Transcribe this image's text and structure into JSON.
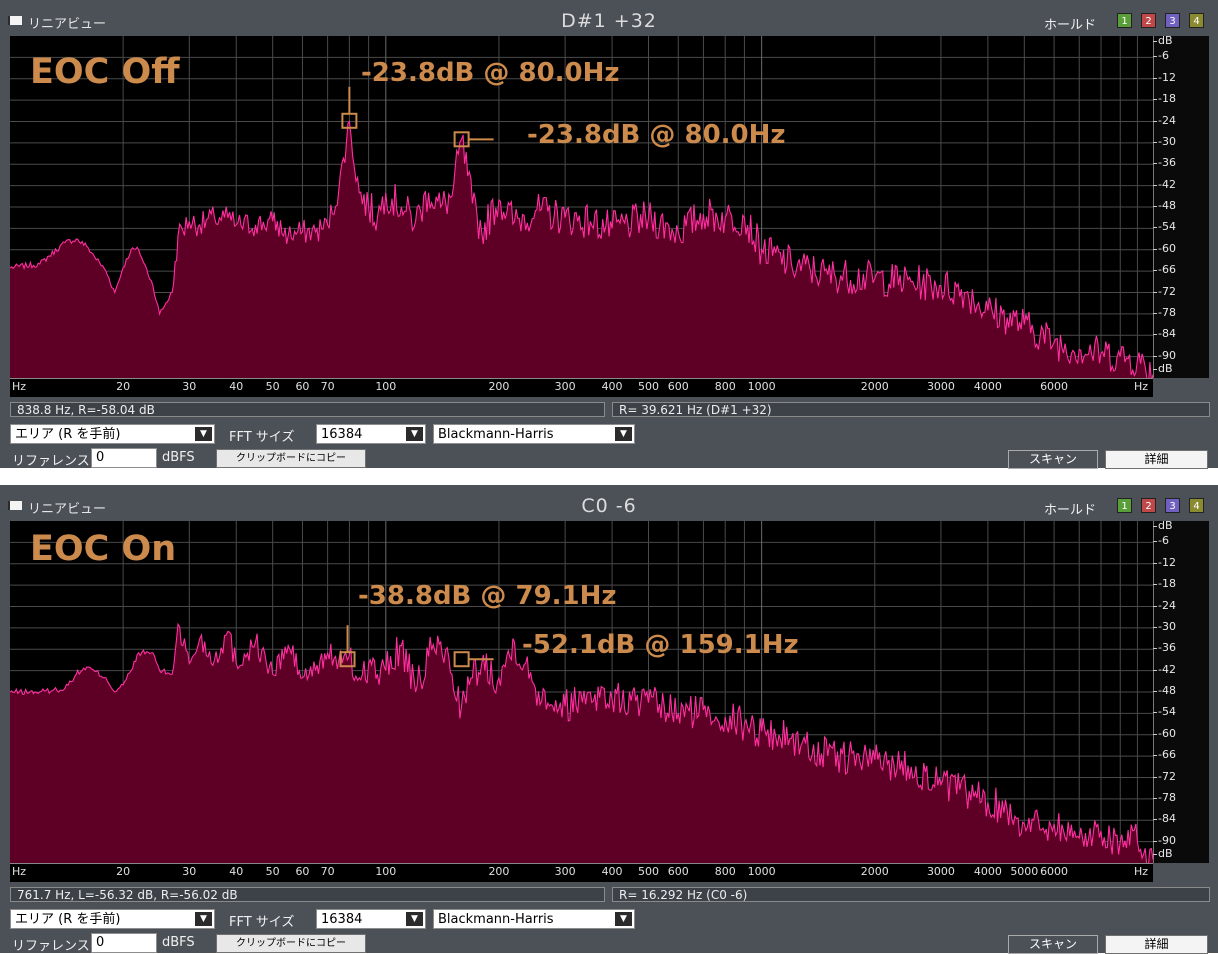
{
  "panels": [
    {
      "window_title": "リニアビュー",
      "note": "D#1  +32",
      "hold_label": "ホールド",
      "hold_buttons": [
        "1",
        "2",
        "3",
        "4"
      ],
      "y_unit": "dB",
      "y_ticks": [
        "-6",
        "-12",
        "-18",
        "-24",
        "-30",
        "-36",
        "-42",
        "-48",
        "-54",
        "-60",
        "-66",
        "-72",
        "-78",
        "-84",
        "-90"
      ],
      "x_unit": "Hz",
      "x_ticks": [
        "20",
        "30",
        "40",
        "50",
        "60",
        "70",
        "100",
        "200",
        "300",
        "400",
        "500",
        "600",
        "800",
        "1000",
        "2000",
        "3000",
        "4000",
        "6000"
      ],
      "cursor_status": "838.8 Hz, R=-58.04 dB",
      "resolution_status": "R= 39.621 Hz (D#1 +32)",
      "mode_select": "エリア (R を手前)",
      "fft_label": "FFT サイズ",
      "fft_size": "16384",
      "window_function": "Blackmann-Harris",
      "reference_label": "リファレンス",
      "reference_value": "0",
      "reference_unit": "dBFS",
      "copy_button": "クリップボードにコピー",
      "scan_button": "スキャン",
      "detail_button": "詳細",
      "overlay_label": "EOC Off",
      "annotation_1": "-23.8dB @ 80.0Hz",
      "annotation_2": "-23.8dB @ 80.0Hz"
    },
    {
      "window_title": "リニアビュー",
      "note": "C0  -6",
      "hold_label": "ホールド",
      "hold_buttons": [
        "1",
        "2",
        "3",
        "4"
      ],
      "y_unit": "dB",
      "y_ticks": [
        "-6",
        "-12",
        "-18",
        "-24",
        "-30",
        "-36",
        "-42",
        "-48",
        "-54",
        "-60",
        "-66",
        "-72",
        "-78",
        "-84",
        "-90"
      ],
      "x_unit": "Hz",
      "x_ticks": [
        "20",
        "30",
        "40",
        "50",
        "60",
        "70",
        "100",
        "200",
        "300",
        "400",
        "500",
        "600",
        "800",
        "1000",
        "2000",
        "3000",
        "4000",
        "5000",
        "6000"
      ],
      "cursor_status": "761.7 Hz, L=-56.32 dB, R=-56.02 dB",
      "resolution_status": "R= 16.292 Hz (C0 -6)",
      "mode_select": "エリア (R を手前)",
      "fft_label": "FFT サイズ",
      "fft_size": "16384",
      "window_function": "Blackmann-Harris",
      "reference_label": "リファレンス",
      "reference_value": "0",
      "reference_unit": "dBFS",
      "copy_button": "クリップボードにコピー",
      "scan_button": "スキャン",
      "detail_button": "詳細",
      "overlay_label": "EOC On",
      "annotation_1": "-38.8dB @ 79.1Hz",
      "annotation_2": "-52.1dB @ 159.1Hz"
    }
  ],
  "colors": {
    "spectrum_fill": "#5e0025",
    "spectrum_line": "#ff2fa0",
    "grid": "#4a4a4a",
    "annotation": "#cc8a4c",
    "hold_1": "#5a9e3a",
    "hold_2": "#c04848",
    "hold_3": "#7060c0",
    "hold_4": "#8a8a30"
  },
  "chart_data": [
    {
      "type": "area",
      "title": "D#1  +32",
      "x_scale": "log",
      "xlim": [
        10,
        11000
      ],
      "ylim": [
        -96,
        0
      ],
      "ylabel": "dB",
      "xlabel": "Hz",
      "grid": true,
      "series": [
        {
          "x": [
            10,
            12,
            14,
            15,
            16,
            18,
            19,
            20,
            21,
            22,
            24,
            25,
            27,
            28,
            30,
            32,
            35,
            38,
            40,
            45,
            50,
            55,
            60,
            65,
            70,
            75,
            80,
            85,
            90,
            95,
            100,
            110,
            120,
            130,
            140,
            150,
            159,
            170,
            180,
            200,
            220,
            250,
            300,
            350,
            400,
            500,
            600,
            700,
            800,
            900,
            1000,
            1200,
            1500,
            2000,
            2500,
            3000,
            3500,
            4000,
            4500,
            5000,
            6000,
            7000,
            8000,
            9000,
            10000,
            11000
          ],
          "y": [
            -65,
            -64,
            -58,
            -57,
            -59,
            -66,
            -72,
            -65,
            -60,
            -60,
            -70,
            -78,
            -72,
            -56,
            -52,
            -53,
            -51,
            -51,
            -53,
            -53,
            -52,
            -56,
            -55,
            -55,
            -53,
            -43,
            -24,
            -44,
            -48,
            -51,
            -44,
            -48,
            -52,
            -44,
            -48,
            -45,
            -29,
            -47,
            -55,
            -46,
            -52,
            -49,
            -51,
            -52,
            -54,
            -51,
            -55,
            -50,
            -51,
            -51,
            -60,
            -64,
            -67,
            -68,
            -69,
            -70,
            -72,
            -77,
            -79,
            -81,
            -86,
            -88,
            -89,
            -90,
            -91,
            -95
          ]
        }
      ]
    },
    {
      "type": "area",
      "title": "C0  -6",
      "x_scale": "log",
      "xlim": [
        10,
        11000
      ],
      "ylim": [
        -96,
        0
      ],
      "ylabel": "dB",
      "xlabel": "Hz",
      "grid": true,
      "series": [
        {
          "x": [
            10,
            12,
            14,
            15,
            16,
            18,
            19,
            20,
            21,
            22,
            24,
            25,
            27,
            28,
            30,
            32,
            35,
            38,
            40,
            45,
            50,
            55,
            60,
            65,
            70,
            75,
            79,
            85,
            90,
            95,
            100,
            110,
            120,
            130,
            140,
            150,
            159,
            170,
            180,
            200,
            220,
            250,
            300,
            350,
            400,
            500,
            600,
            700,
            800,
            900,
            1000,
            1200,
            1500,
            2000,
            2500,
            3000,
            3500,
            4000,
            4500,
            5000,
            6000,
            7000,
            8000,
            9000,
            10000,
            11000
          ],
          "y": [
            -48,
            -48,
            -47,
            -43,
            -41,
            -44,
            -48,
            -46,
            -42,
            -37,
            -37,
            -42,
            -43,
            -29,
            -40,
            -33,
            -39,
            -31,
            -40,
            -34,
            -43,
            -35,
            -44,
            -42,
            -37,
            -39,
            -39,
            -44,
            -40,
            -43,
            -42,
            -35,
            -48,
            -38,
            -34,
            -43,
            -52,
            -44,
            -40,
            -44,
            -34,
            -47,
            -52,
            -48,
            -50,
            -51,
            -54,
            -53,
            -55,
            -57,
            -59,
            -61,
            -66,
            -67,
            -69,
            -74,
            -76,
            -79,
            -81,
            -85,
            -85,
            -89,
            -87,
            -90,
            -90,
            -95
          ]
        }
      ]
    }
  ]
}
